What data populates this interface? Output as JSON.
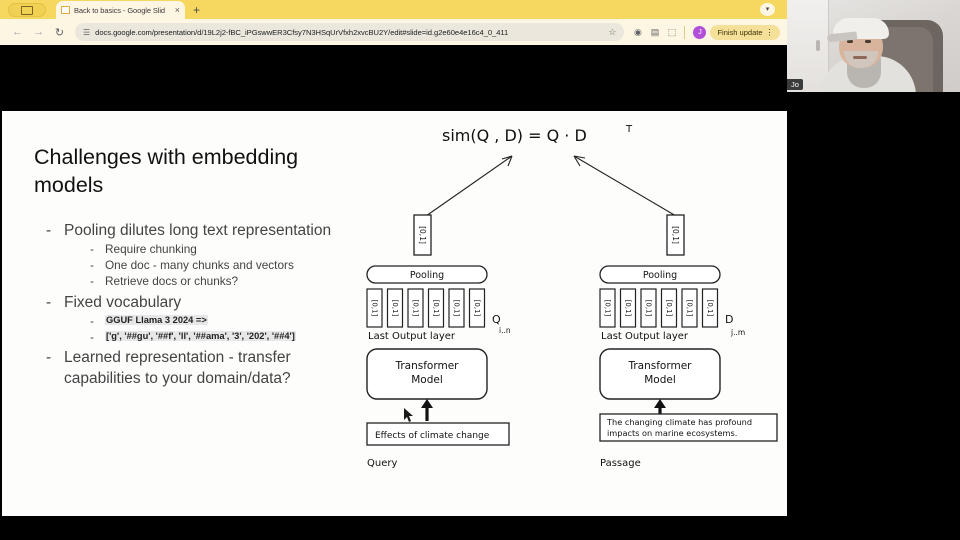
{
  "browser": {
    "tab": {
      "title": "Back to basics - Google Slid",
      "close_label": "×",
      "favicon_name": "slides-favicon"
    },
    "new_tab_label": "+",
    "tabstrip_chevron": "▾",
    "tab_group_chip": "tab-group-chip",
    "nav": {
      "back": "←",
      "forward": "→",
      "reload": "↻"
    },
    "omnibox": {
      "site_settings_icon": "☰",
      "url": "docs.google.com/presentation/d/19L2j2-fBC_iPGswwER3Cfsy7N3HSqUrVfxh2xvcBU2Y/edit#slide=id.g2e60e4e16c4_0_411",
      "bookmark_star": "☆"
    },
    "toolbar_icons": {
      "extension": "◉",
      "media_cast": "▤",
      "side_panel": "⬚"
    },
    "profile_initial": "J",
    "finish_update_label": "Finish update",
    "kebab_label": "⋮"
  },
  "slide": {
    "title": "Challenges with embedding models",
    "bullets": [
      {
        "dash": "-",
        "text": "Pooling dilutes long text representation",
        "sub": [
          {
            "dash": "-",
            "text": "Require chunking",
            "style": "plain"
          },
          {
            "dash": "-",
            "text": "One doc - many chunks and vectors",
            "style": "plain"
          },
          {
            "dash": "-",
            "text": "Retrieve docs or chunks?",
            "style": "plain"
          }
        ]
      },
      {
        "dash": "-",
        "text": "Fixed vocabulary",
        "sub": [
          {
            "dash": "-",
            "text": "GGUF Llama 3 2024 =>",
            "style": "highlight"
          },
          {
            "dash": "-",
            "text": "['g', '##gu', '##f', 'll', '##ama', '3', '202', '##4']",
            "style": "highlight"
          }
        ]
      },
      {
        "dash": "-",
        "text": "Learned representation - transfer capabilities to your domain/data?",
        "sub": []
      }
    ],
    "diagram": {
      "formula": "sim(Q , D)  =  Q · D",
      "formula_sup": "T",
      "left": {
        "pooling_label": "Pooling",
        "vector_label": "[0,1]",
        "token_count": 6,
        "layer_label": "Last Output layer",
        "matrix_symbol": "Q",
        "matrix_subscript": "i..n",
        "model_line1": "Transformer",
        "model_line2": "Model",
        "input_text": "Effects of climate change",
        "caption": "Query"
      },
      "right": {
        "pooling_label": "Pooling",
        "vector_label": "[0,1]",
        "token_count": 6,
        "layer_label": "Last Output layer",
        "matrix_symbol": "D",
        "matrix_subscript": "j..m",
        "model_line1": "Transformer",
        "model_line2": "Model",
        "input_text_line1": "The changing climate has profound",
        "input_text_line2": "impacts on marine ecosystems.",
        "caption": "Passage"
      }
    }
  },
  "webcam": {
    "participant_name": "Jo"
  },
  "colors": {
    "browser_chrome": "#f6d860",
    "toolbar": "#fdf6e2",
    "accent_pill": "#f5e09a",
    "avatar": "#b14fd8",
    "slide_bg": "#fdfdfc",
    "highlight": "#e7e7e7"
  }
}
